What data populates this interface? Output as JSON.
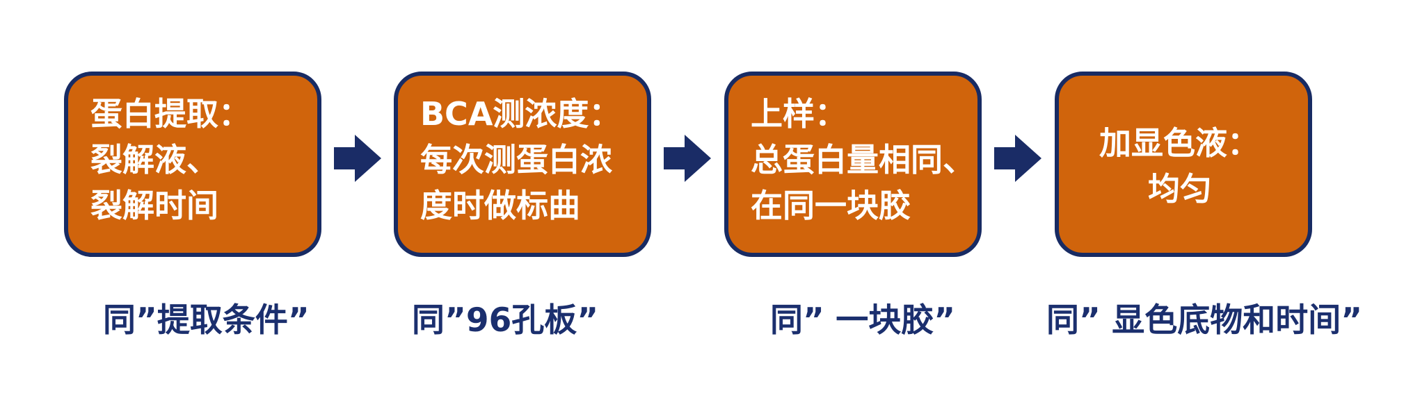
{
  "steps": [
    {
      "title": "蛋白提取：",
      "lines": [
        "裂解液、",
        "裂解时间"
      ],
      "caption": "同”提取条件”"
    },
    {
      "title": "BCA测浓度：",
      "lines": [
        "每次测蛋白浓",
        "度时做标曲"
      ],
      "caption": "同”96孔板”"
    },
    {
      "title": "上样：",
      "lines": [
        "总蛋白量相同、",
        "在同一块胶"
      ],
      "caption": "同” 一块胶”"
    },
    {
      "title": "加显色液：",
      "lines": [
        "均匀"
      ],
      "caption": "同” 显色底物和时间”"
    }
  ],
  "colors": {
    "box_fill": "#d0640c",
    "box_border": "#182b63",
    "arrow": "#1a2c66",
    "caption": "#1b2f6e"
  },
  "icons": {
    "connector": "right-arrow-icon"
  }
}
